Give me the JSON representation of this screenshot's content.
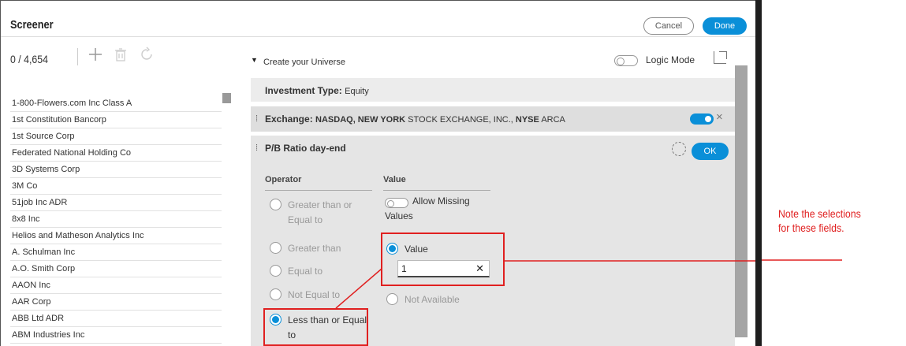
{
  "header": {
    "title": "Screener",
    "cancel_label": "Cancel",
    "done_label": "Done"
  },
  "toolbar": {
    "count": "0 / 4,654",
    "icons": [
      "plus-icon",
      "trash-icon",
      "refresh-icon"
    ]
  },
  "list": {
    "items": [
      "1-800-Flowers.com Inc Class A",
      "1st Constitution Bancorp",
      "1st Source Corp",
      "Federated National Holding Co",
      "3D Systems Corp",
      "3M Co",
      "51job Inc ADR",
      "8x8 Inc",
      "Helios and Matheson Analytics Inc",
      "A. Schulman Inc",
      "A.O. Smith Corp",
      "AAON Inc",
      "AAR Corp",
      "ABB Ltd ADR",
      "ABM Industries Inc"
    ]
  },
  "universe": {
    "label": "Create your Universe",
    "logic_mode_label": "Logic Mode"
  },
  "criteria": {
    "investment_type": {
      "label": "Investment Type:",
      "value": "Equity"
    },
    "exchange": {
      "label": "Exchange:",
      "value_parts": [
        "NASDAQ, NEW YORK",
        " STOCK EXCHANGE, INC., ",
        "NYSE",
        " ARCA"
      ]
    },
    "pb_ratio": {
      "label": "P/B Ratio day-end",
      "ok_label": "OK",
      "operator_header": "Operator",
      "value_header": "Value",
      "operators": [
        {
          "label_line1": "Greater than or",
          "label_line2": "Equal to",
          "selected": false
        },
        {
          "label_line1": "Greater than",
          "label_line2": "",
          "selected": false
        },
        {
          "label_line1": "Equal to",
          "label_line2": "",
          "selected": false
        },
        {
          "label_line1": "Not Equal to",
          "label_line2": "",
          "selected": false
        },
        {
          "label_line1": "Less than or Equal",
          "label_line2": "to",
          "selected": true
        }
      ],
      "allow_missing_line1": "Allow Missing",
      "allow_missing_line2": "Values",
      "value_option_label": "Value",
      "value_input": "1",
      "not_available_label": "Not Available"
    }
  },
  "callout": {
    "line1": "Note the selections",
    "line2": "for these fields."
  },
  "colors": {
    "accent": "#0a8fd8",
    "highlight": "#e02020"
  }
}
